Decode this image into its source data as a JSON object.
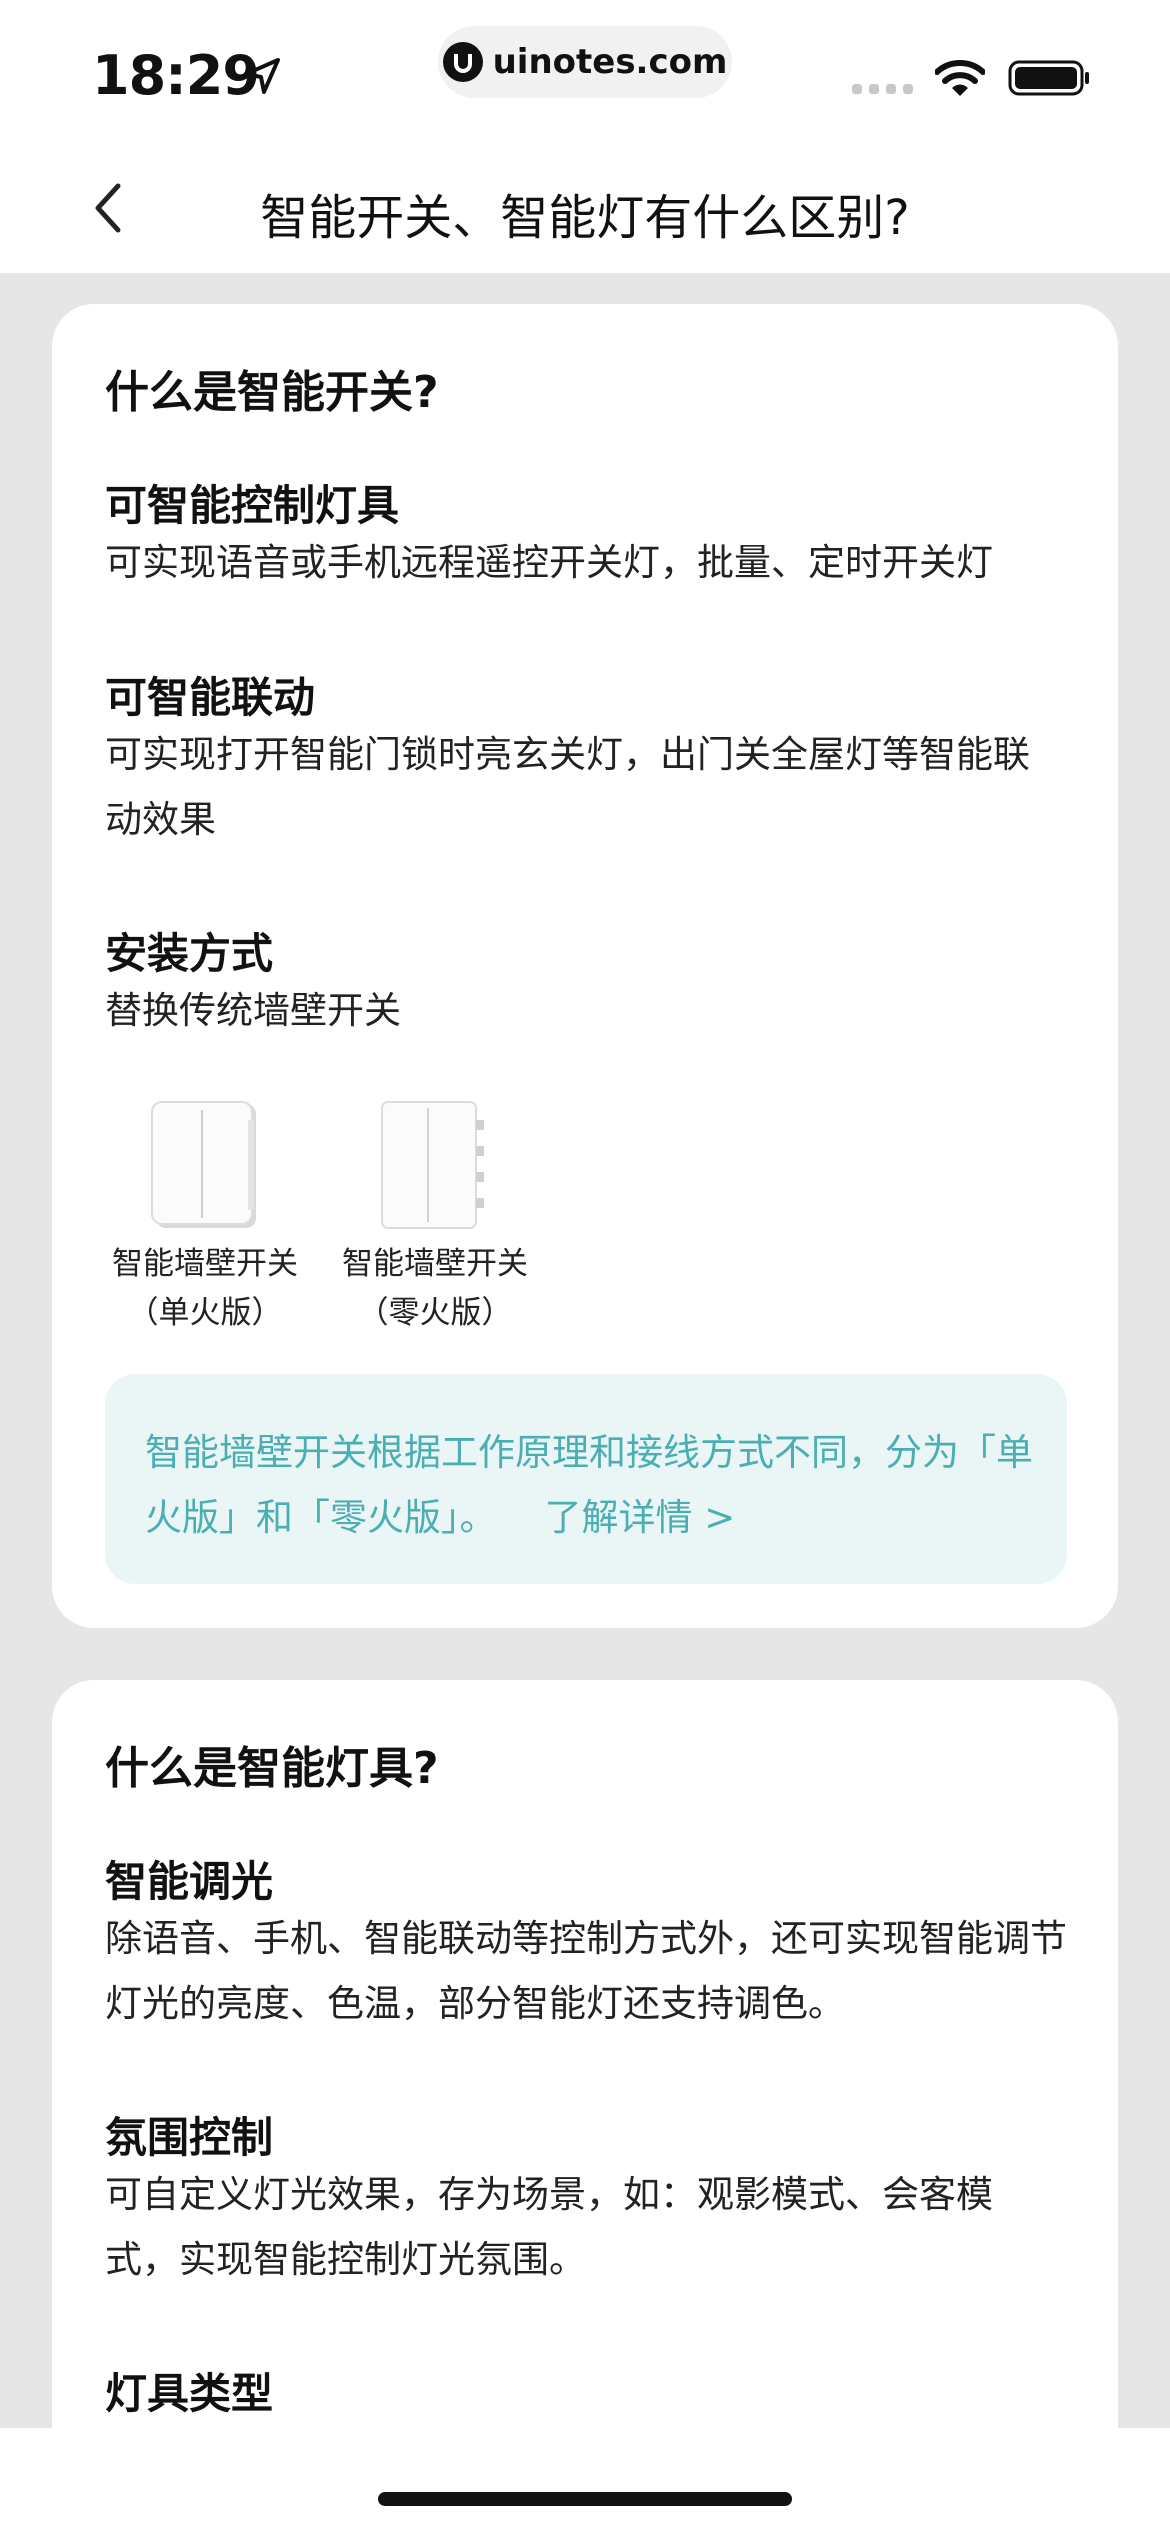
{
  "status": {
    "time": "18:29",
    "url": "uinotes.com"
  },
  "nav": {
    "title": "智能开关、智能灯有什么区别?"
  },
  "switch_card": {
    "title": "什么是智能开关?",
    "sections": [
      {
        "heading": "可智能控制灯具",
        "body": "可实现语音或手机远程遥控开关灯，批量、定时开关灯"
      },
      {
        "heading": "可智能联动",
        "body": "可实现打开智能门锁时亮玄关灯，出门关全屋灯等智能联动效果"
      },
      {
        "heading": "安装方式",
        "body": "替换传统墙壁开关"
      }
    ],
    "products": [
      {
        "name": "智能墙壁开关",
        "variant": "（单火版）"
      },
      {
        "name": "智能墙壁开关",
        "variant": "（零火版）"
      }
    ],
    "note": {
      "text": "智能墙壁开关根据工作原理和接线方式不同，分为「单火版」和「零火版」。",
      "link": "了解详情 >"
    }
  },
  "light_card": {
    "title": "什么是智能灯具?",
    "sections": [
      {
        "heading": "智能调光",
        "body": "除语音、手机、智能联动等控制方式外，还可实现智能调节灯光的亮度、色温，部分智能灯还支持调色。"
      },
      {
        "heading": "氛围控制",
        "body": "可自定义灯光效果，存为场景，如：观影模式、会客模式，实现智能控制灯光氛围。"
      },
      {
        "heading": "灯具类型",
        "body": ""
      }
    ]
  },
  "colors": {
    "background": "#e6e6e6",
    "card": "#ffffff",
    "note_bg": "#eaf6f6",
    "note_text": "#4aaeb2"
  }
}
